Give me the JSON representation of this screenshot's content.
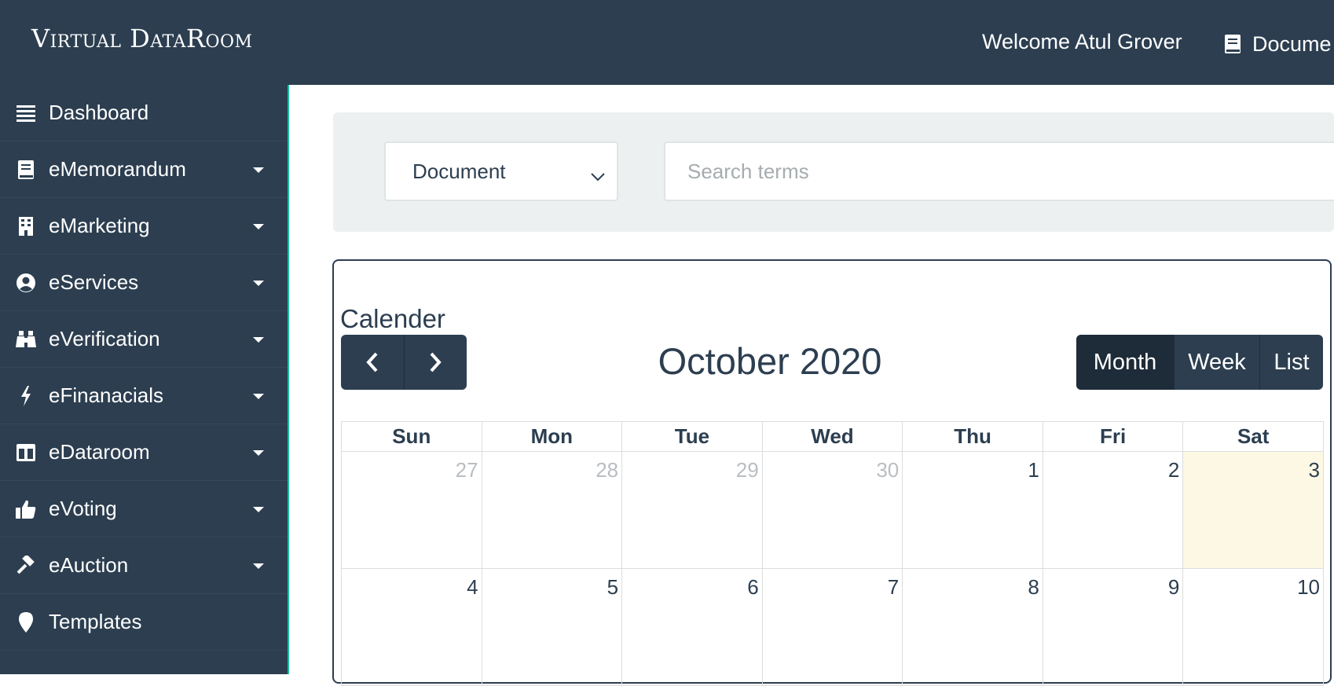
{
  "header": {
    "brand": "Virtual DataRoom",
    "welcome": "Welcome Atul Grover",
    "docs_label": "Docume",
    "docs_icon": "book-icon"
  },
  "sidebar": {
    "items": [
      {
        "label": "Dashboard",
        "icon": "list-icon",
        "has_caret": false
      },
      {
        "label": "eMemorandum",
        "icon": "book-icon",
        "has_caret": true
      },
      {
        "label": "eMarketing",
        "icon": "building-icon",
        "has_caret": true
      },
      {
        "label": "eServices",
        "icon": "user-circle-icon",
        "has_caret": true
      },
      {
        "label": "eVerification",
        "icon": "binoculars-icon",
        "has_caret": true
      },
      {
        "label": "eFinanacials",
        "icon": "bolt-icon",
        "has_caret": true
      },
      {
        "label": "eDataroom",
        "icon": "columns-icon",
        "has_caret": true
      },
      {
        "label": "eVoting",
        "icon": "thumbs-up-icon",
        "has_caret": true
      },
      {
        "label": "eAuction",
        "icon": "gavel-icon",
        "has_caret": true
      },
      {
        "label": "Templates",
        "icon": "map-marker-icon",
        "has_caret": false
      }
    ]
  },
  "search": {
    "select_value": "Document",
    "placeholder": "Search terms"
  },
  "calendar": {
    "title": "Calender",
    "month_title": "October 2020",
    "views": [
      "Month",
      "Week",
      "List"
    ],
    "active_view": "Month",
    "day_headers": [
      "Sun",
      "Mon",
      "Tue",
      "Wed",
      "Thu",
      "Fri",
      "Sat"
    ],
    "weeks": [
      [
        "27",
        "28",
        "29",
        "30",
        "1",
        "2",
        "3"
      ],
      [
        "4",
        "5",
        "6",
        "7",
        "8",
        "9",
        "10"
      ]
    ],
    "other_month_days_first_week": 4,
    "today": "3"
  },
  "colors": {
    "primary": "#2c3e50",
    "accent": "#1abc9c",
    "panel": "#ecf0f1",
    "today_highlight": "#fcf8e3"
  }
}
